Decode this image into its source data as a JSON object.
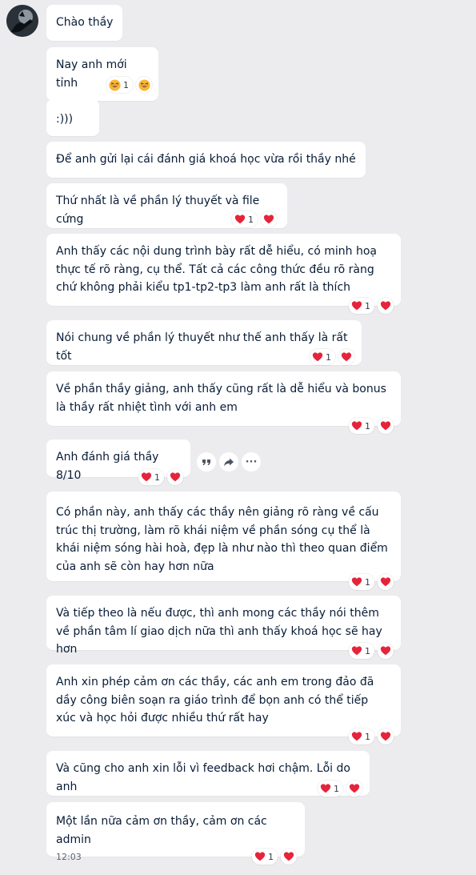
{
  "chat": {
    "messages": [
      {
        "text": "Chào thầy"
      },
      {
        "text": "Nay anh mới tỉnh",
        "reaction_icon": "laugh-emoji",
        "reaction_count": "1",
        "react_button_icon": "laugh-emoji"
      },
      {
        "text": ":)))"
      },
      {
        "text": "Để anh gửi lại cái đánh giá khoá học vừa rồi thầy nhé"
      },
      {
        "text": "Thứ nhất là về phần lý thuyết và file cứng",
        "reaction_icon": "heart",
        "reaction_count": "1"
      },
      {
        "text": "Anh thấy các nội dung trình bày rất dễ hiểu, có minh hoạ thực tế rõ ràng, cụ thể. Tất cả các công thức đều rõ ràng chứ không phải kiểu tp1-tp2-tp3 làm anh rất là thích",
        "reaction_icon": "heart",
        "reaction_count": "1"
      },
      {
        "text": "Nói chung về phần lý thuyết như thế anh thấy là rất tốt",
        "reaction_icon": "heart",
        "reaction_count": "1"
      },
      {
        "text": "Về phần thầy giảng, anh thấy cũng rất là dễ hiểu và bonus là thầy rất nhiệt tình với anh em",
        "reaction_icon": "heart",
        "reaction_count": "1"
      },
      {
        "text": "Anh đánh giá thầy 8/10",
        "reaction_icon": "heart",
        "reaction_count": "1"
      },
      {
        "text": "Có phần này, anh thấy các thầy nên giảng rõ ràng về cấu trúc thị trường, làm rõ khái niệm về phần sóng cụ thể là khái niệm sóng hài hoà, đẹp là như nào thì theo quan điểm của anh sẽ còn hay hơn nữa",
        "reaction_icon": "heart",
        "reaction_count": "1"
      },
      {
        "text": "Và tiếp theo là nếu được, thì anh mong các thầy nói thêm về phần tâm lí giao dịch nữa thì anh thấy khoá học sẽ hay hơn",
        "reaction_icon": "heart",
        "reaction_count": "1"
      },
      {
        "text": "Anh xin phép cảm ơn các thầy, các anh em trong đảo đã dầy công biên soạn ra giáo trình để bọn anh có thể tiếp xúc và học hỏi được nhiều thứ rất hay",
        "reaction_icon": "heart",
        "reaction_count": "1"
      },
      {
        "text": "Và cũng cho anh xin lỗi vì feedback hơi chậm. Lỗi do anh",
        "reaction_icon": "heart",
        "reaction_count": "1"
      },
      {
        "text": "Một lần nữa cảm ơn thầy, cảm ơn các admin",
        "time": "12:03",
        "reaction_icon": "heart",
        "reaction_count": "1"
      }
    ],
    "hover_actions": [
      "quote-icon",
      "forward-icon",
      "more-icon"
    ],
    "more_label": "···",
    "colors": {
      "background": "#ececef",
      "bubble": "#ffffff",
      "heart": "#e5243b",
      "text": "#081c36"
    }
  }
}
